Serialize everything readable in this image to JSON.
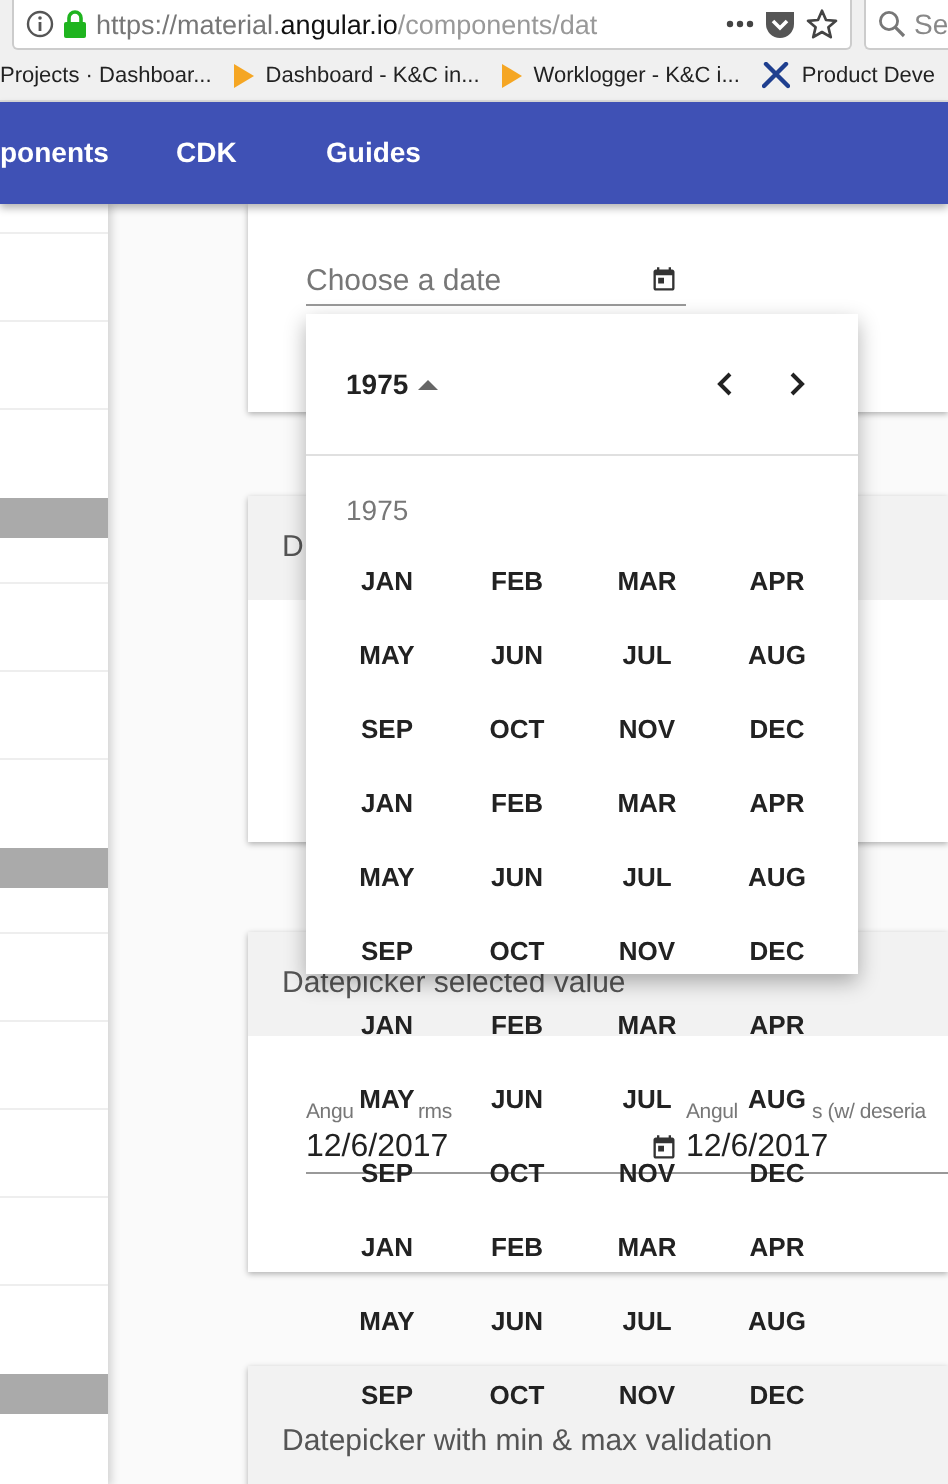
{
  "browser": {
    "url": {
      "prefix": "https://material.",
      "domain": "angular.io",
      "path": "/components/dat"
    },
    "search": {
      "placeholder": "Se"
    }
  },
  "bookmarks": [
    {
      "label": "Projects · Dashboar...",
      "kind": "plain"
    },
    {
      "label": "Dashboard - K&C in...",
      "kind": "play"
    },
    {
      "label": "Worklogger - K&C i...",
      "kind": "play"
    },
    {
      "label": "Product Deve",
      "kind": "tools"
    }
  ],
  "nav": [
    {
      "label": "ponents"
    },
    {
      "label": "CDK"
    },
    {
      "label": "Guides"
    }
  ],
  "sidebar": [
    {
      "kind": "item"
    },
    {
      "kind": "item"
    },
    {
      "kind": "item"
    },
    {
      "kind": "header"
    },
    {
      "kind": "item"
    },
    {
      "kind": "item"
    },
    {
      "kind": "item"
    },
    {
      "kind": "header"
    },
    {
      "kind": "item"
    },
    {
      "kind": "item"
    },
    {
      "kind": "item"
    },
    {
      "kind": "item"
    },
    {
      "kind": "item"
    },
    {
      "kind": "header"
    }
  ],
  "cards": [
    {
      "fields": [
        {
          "placeholder": "Choose a date",
          "toggle": true
        }
      ]
    },
    {
      "title": "D"
    },
    {
      "title": "Datepicker selected value",
      "fields": [
        {
          "label_parts": [
            "Angu",
            "rms"
          ],
          "value": "12/6/2017",
          "toggle": true
        },
        {
          "label_parts": [
            "Angul",
            "s (w/ deseria"
          ],
          "value": "12/6/2017",
          "toggle": false
        }
      ]
    },
    {
      "title": "Datepicker with min & max validation"
    }
  ],
  "datepicker": {
    "period": "1975",
    "year_label": "1975",
    "rows": [
      [
        "JAN",
        "FEB",
        "MAR",
        "APR"
      ],
      [
        "MAY",
        "JUN",
        "JUL",
        "AUG"
      ],
      [
        "SEP",
        "OCT",
        "NOV",
        "DEC"
      ],
      [
        "JAN",
        "FEB",
        "MAR",
        "APR"
      ],
      [
        "MAY",
        "JUN",
        "JUL",
        "AUG"
      ],
      [
        "SEP",
        "OCT",
        "NOV",
        "DEC"
      ],
      [
        "JAN",
        "FEB",
        "MAR",
        "APR"
      ],
      [
        "MAY",
        "JUN",
        "JUL",
        "AUG"
      ],
      [
        "SEP",
        "OCT",
        "NOV",
        "DEC"
      ],
      [
        "JAN",
        "FEB",
        "MAR",
        "APR"
      ],
      [
        "MAY",
        "JUN",
        "JUL",
        "AUG"
      ],
      [
        "SEP",
        "OCT",
        "NOV",
        "DEC"
      ]
    ]
  }
}
